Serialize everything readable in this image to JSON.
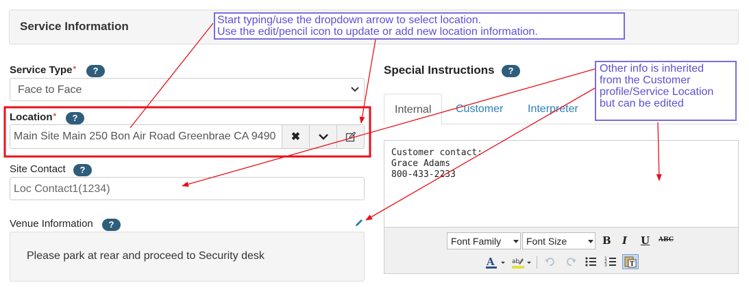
{
  "panel": {
    "title": "Service Information"
  },
  "service_type": {
    "label": "Service Type",
    "required_mark": "*",
    "help": "?",
    "selected": "Face to Face"
  },
  "location": {
    "label": "Location",
    "required_mark": "*",
    "help": "?",
    "value": "Main Site Main 250 Bon Air Road Greenbrae CA 9490",
    "buttons": {
      "clear": "✖",
      "dropdown": "chevron-down-icon",
      "edit": "edit-pencil-icon"
    }
  },
  "site_contact": {
    "label": "Site Contact",
    "help": "?",
    "value": "Loc Contact1(1234)"
  },
  "venue": {
    "label": "Venue Information",
    "help": "?",
    "text": "Please park at rear and proceed to Security desk"
  },
  "special_instructions": {
    "label": "Special Instructions",
    "help": "?",
    "tabs": [
      "Internal",
      "Customer",
      "Interpreter"
    ],
    "active_tab": "Internal",
    "content_lines": [
      "Customer contact:",
      "Grace Adams",
      "800-433-2233"
    ],
    "toolbar": {
      "font_family": "Font Family",
      "font_size": "Font Size",
      "bold": "B",
      "italic": "I",
      "underline": "U",
      "strike": "ABC"
    }
  },
  "annotations": {
    "top_lines": [
      "Start typing/use the dropdown arrow to select location.",
      "Use the edit/pencil icon to update or add new location information."
    ],
    "right_lines": [
      "Other info is inherited",
      "from the Customer",
      "profile/Service Location",
      "but can be edited"
    ]
  },
  "colors": {
    "accent_link": "#2a7fb8",
    "help_badge": "#2f5d7c",
    "required": "#d9534f",
    "annotation_text": "#5c4fd6",
    "annotation_border": "#7b6cd9",
    "highlight_box": "#e8101a",
    "arrow": "#e8101a"
  }
}
